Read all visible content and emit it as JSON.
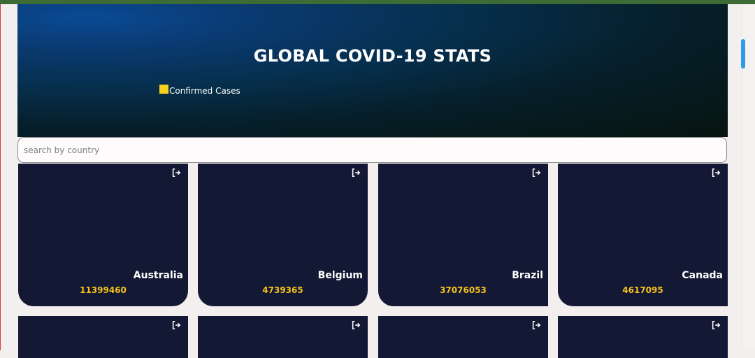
{
  "header": {
    "title": "GLOBAL COVID-19 STATS",
    "legend_label": "Confirmed Cases"
  },
  "search": {
    "placeholder": "search by country",
    "value": ""
  },
  "cards": [
    {
      "country": "Australia",
      "cases": "11399460"
    },
    {
      "country": "Belgium",
      "cases": "4739365"
    },
    {
      "country": "Brazil",
      "cases": "37076053"
    },
    {
      "country": "Canada",
      "cases": "4617095"
    }
  ],
  "colors": {
    "card_bg": "#131934",
    "accent_yellow": "#f6c21b",
    "legend_swatch": "#f7d21a",
    "scrollbar": "#2f9be8"
  },
  "icons": {
    "card_action": "external-link-icon"
  }
}
